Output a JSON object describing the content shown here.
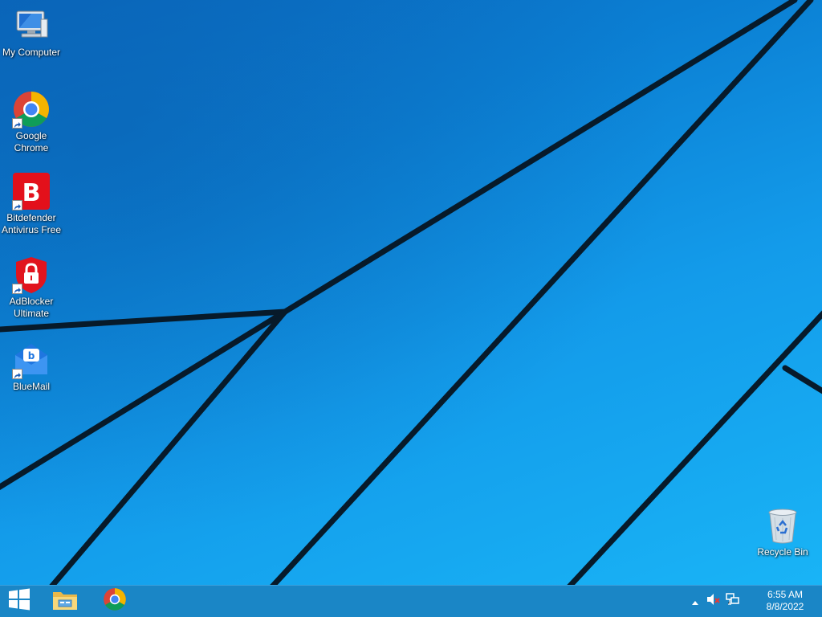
{
  "desktop": {
    "icons": [
      {
        "label": "My Computer",
        "icon": "computer-icon"
      },
      {
        "label": "Google Chrome",
        "icon": "chrome-icon"
      },
      {
        "label": "Bitdefender Antivirus Free",
        "icon": "bitdefender-icon"
      },
      {
        "label": "AdBlocker Ultimate",
        "icon": "adblocker-icon"
      },
      {
        "label": "BlueMail",
        "icon": "bluemail-icon"
      },
      {
        "label": "Recycle Bin",
        "icon": "recycle-bin-icon"
      }
    ]
  },
  "taskbar": {
    "start_icon": "windows-logo-icon",
    "pinned": [
      {
        "name": "File Explorer",
        "icon": "folder-icon"
      },
      {
        "name": "Google Chrome",
        "icon": "chrome-icon"
      }
    ],
    "tray": {
      "icons": [
        "chevron-up-icon",
        "speaker-muted-icon",
        "network-icon"
      ],
      "time": "6:55 AM",
      "date": "8/8/2022"
    }
  },
  "colors": {
    "taskbar": "#1a86c6",
    "wallpaper_light": "#19b4f6",
    "wallpaper_dark": "#0a68bf"
  }
}
